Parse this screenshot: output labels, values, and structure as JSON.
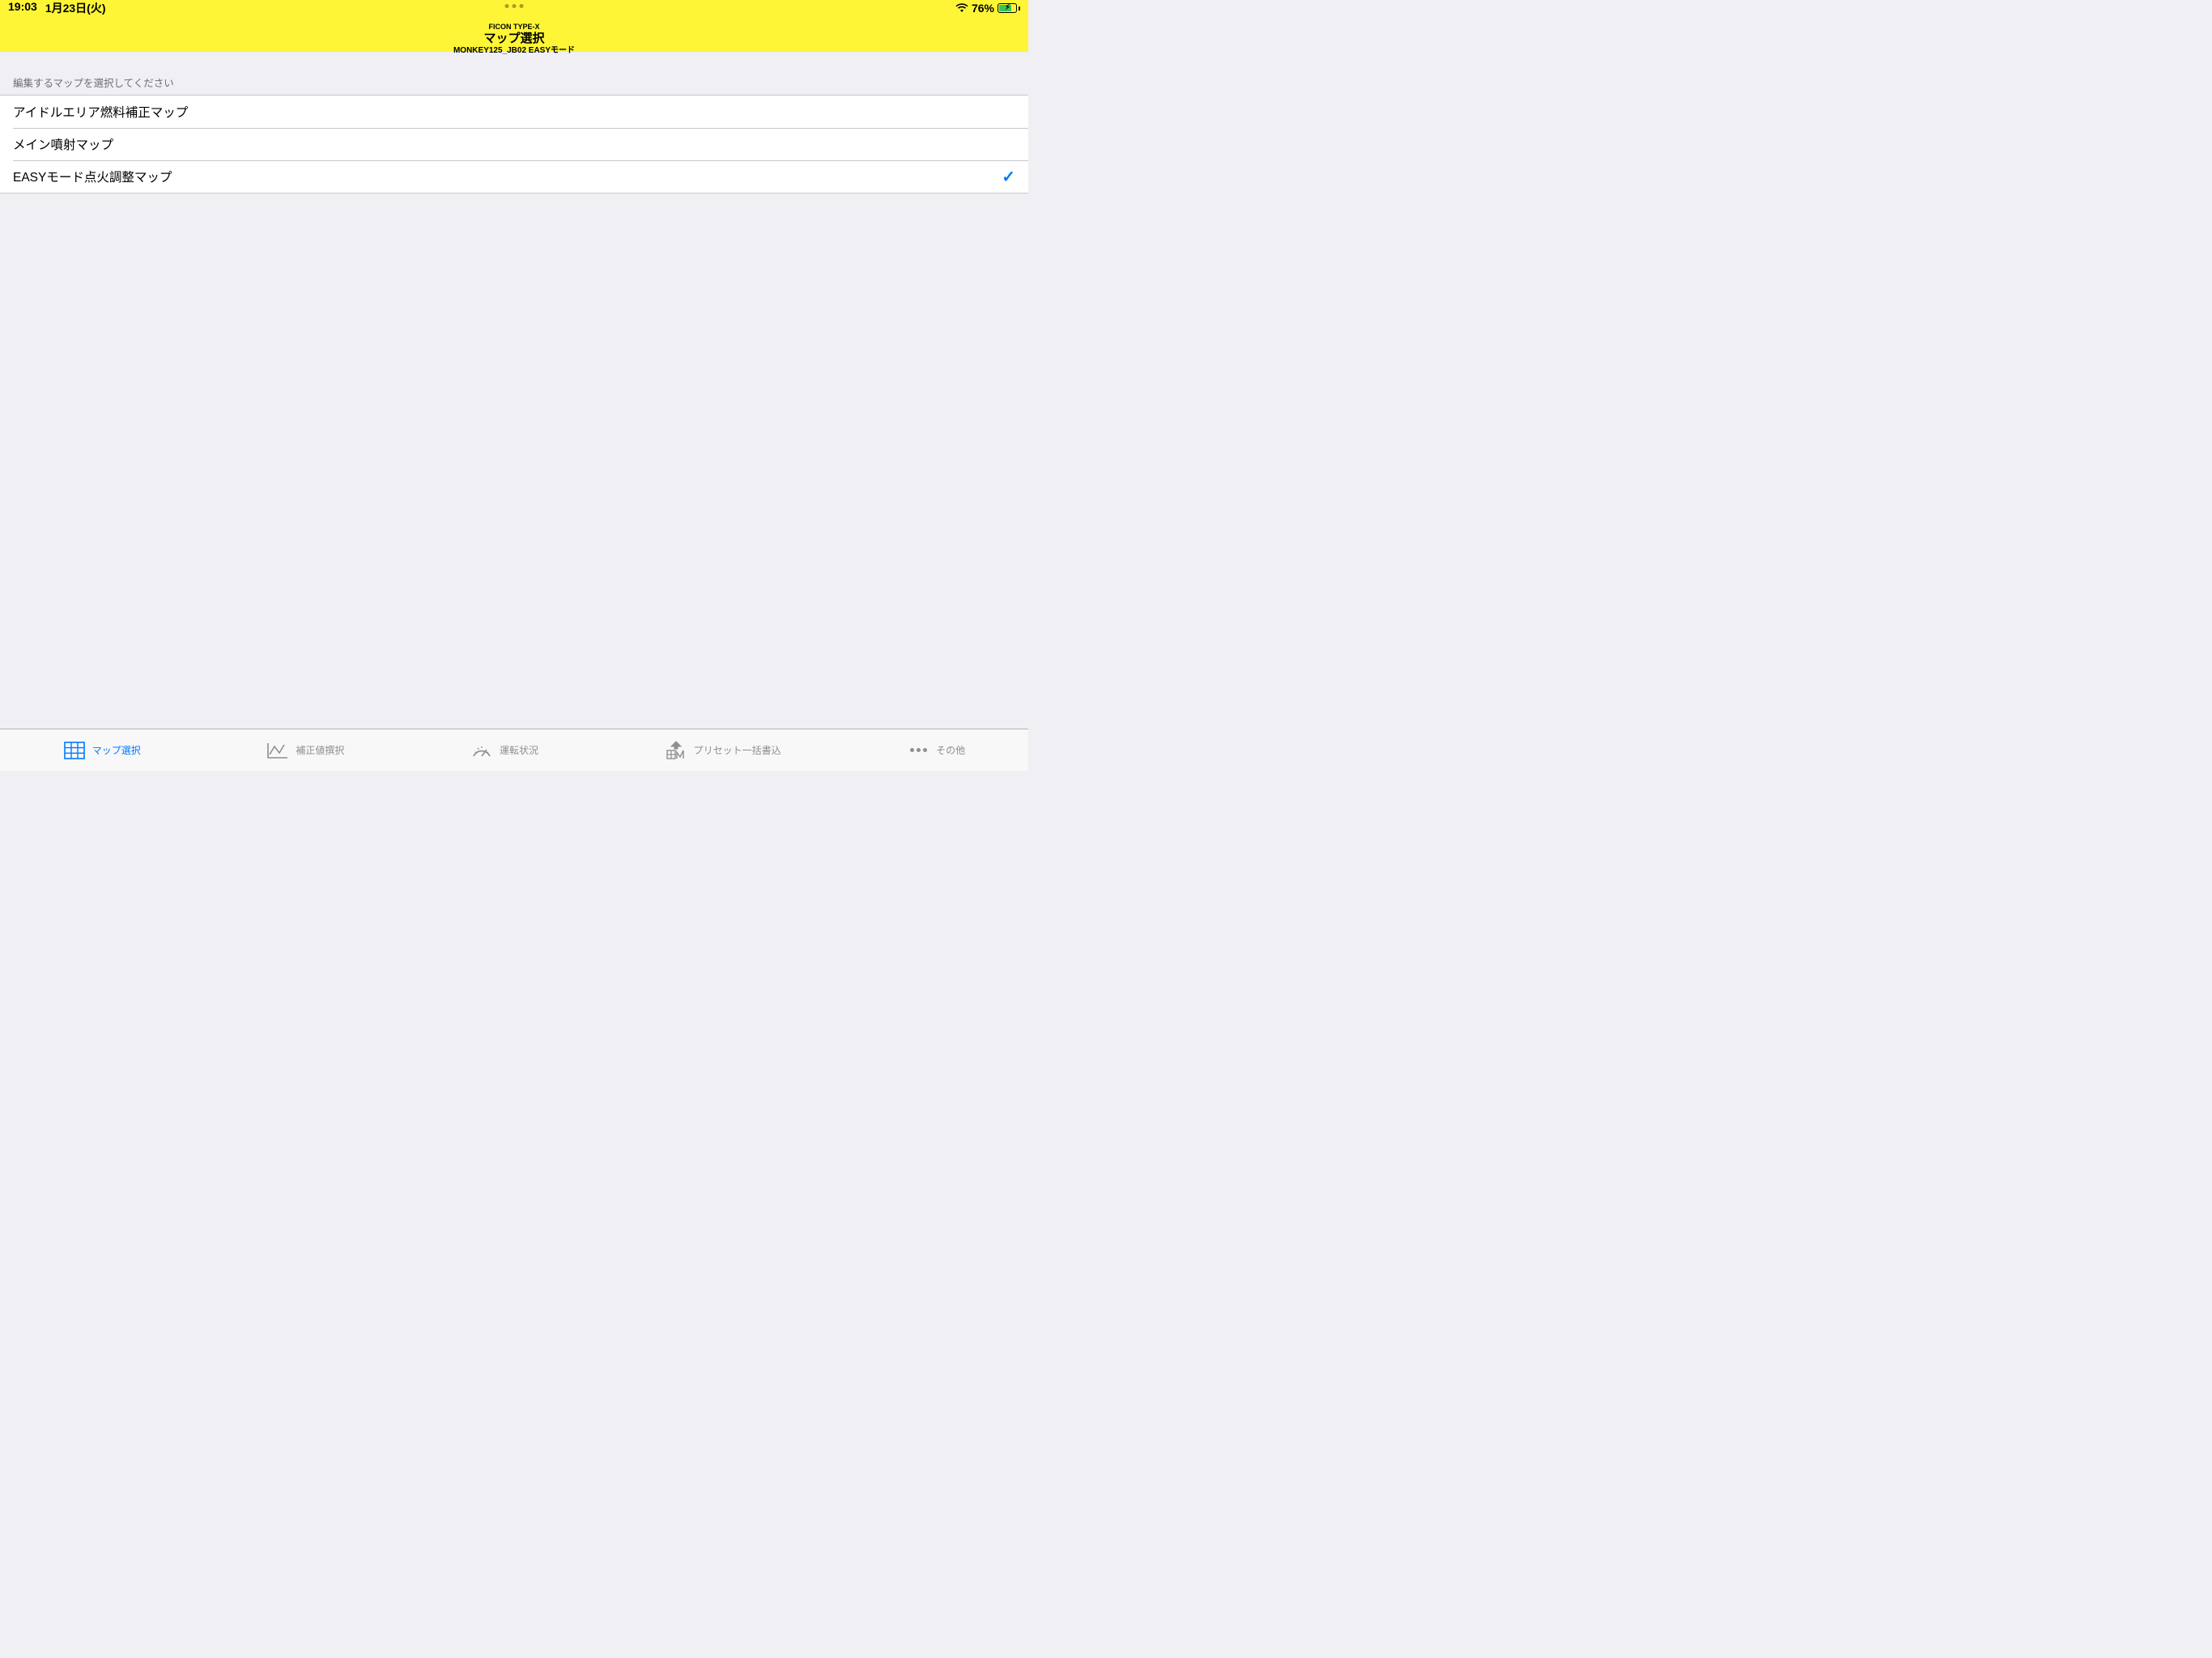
{
  "status": {
    "time": "19:03",
    "date": "1月23日(火)",
    "battery_pct": "76%"
  },
  "header": {
    "super": "FICON TYPE-X",
    "title": "マップ選択",
    "sub": "MONKEY125_JB02 EASYモード"
  },
  "section": {
    "prompt": "編集するマップを選択してください"
  },
  "maps": [
    {
      "label": "アイドルエリア燃料補正マップ",
      "selected": false
    },
    {
      "label": "メイン噴射マップ",
      "selected": false
    },
    {
      "label": "EASYモード点火調整マップ",
      "selected": true
    }
  ],
  "tabs": [
    {
      "label": "マップ選択"
    },
    {
      "label": "補正値撰択"
    },
    {
      "label": "運転状況"
    },
    {
      "label": "プリセット一括書込"
    },
    {
      "label": "その他"
    }
  ]
}
